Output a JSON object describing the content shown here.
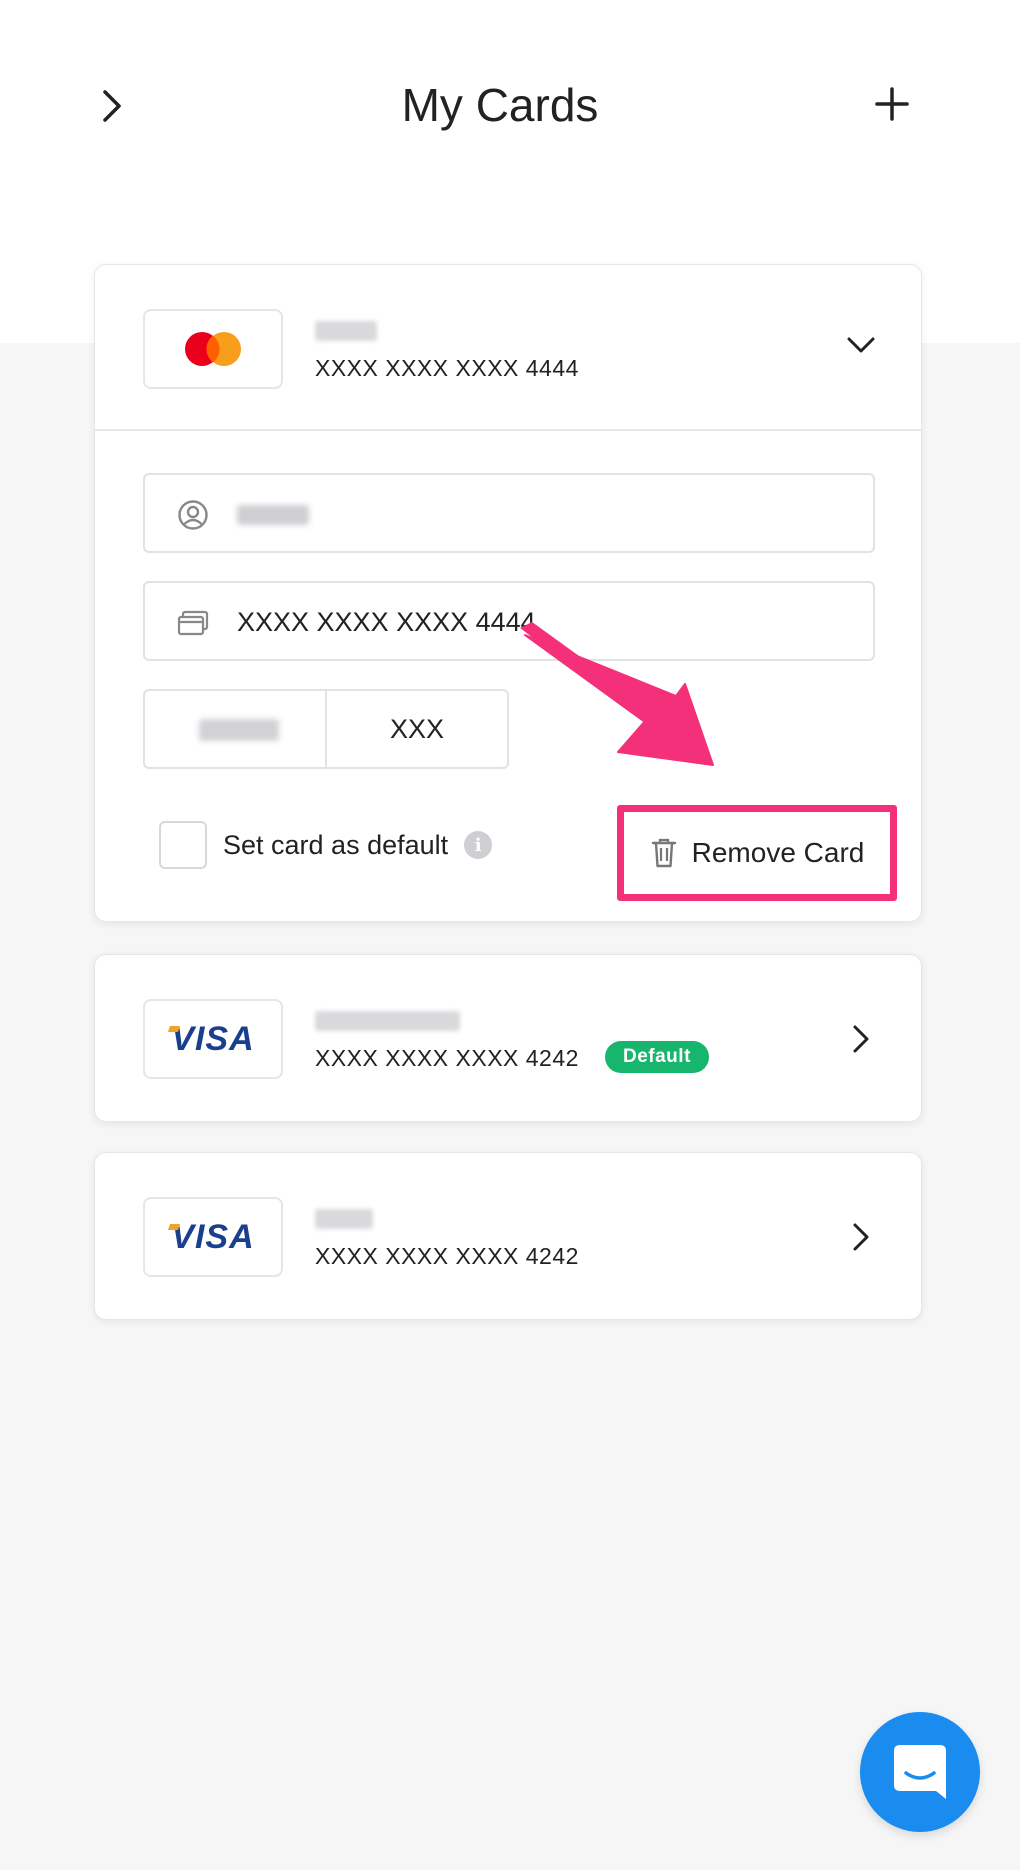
{
  "header": {
    "title": "My Cards",
    "back_icon": "chevron-right-icon",
    "add_icon": "plus-icon"
  },
  "cards": [
    {
      "brand": "mastercard",
      "brand_colors": [
        "#eb001b",
        "#f79e1b"
      ],
      "number": "XXXX XXXX XXXX 4444",
      "expanded": true,
      "form": {
        "number_value": "XXXX XXXX XXXX 4444",
        "cvc_value": "XXX",
        "default_checkbox_label": "Set card as default",
        "remove_label": "Remove Card"
      }
    },
    {
      "brand": "visa",
      "brand_label": "VISA",
      "number": "XXXX XXXX XXXX 4242",
      "badge": "Default",
      "expanded": false
    },
    {
      "brand": "visa",
      "brand_label": "VISA",
      "number": "XXXX XXXX XXXX 4242",
      "expanded": false
    }
  ],
  "colors": {
    "highlight": "#f5307a",
    "default_badge": "#17b66c",
    "chat_button": "#1a8cf0"
  },
  "chat": {
    "icon": "chat-bubble-icon"
  }
}
